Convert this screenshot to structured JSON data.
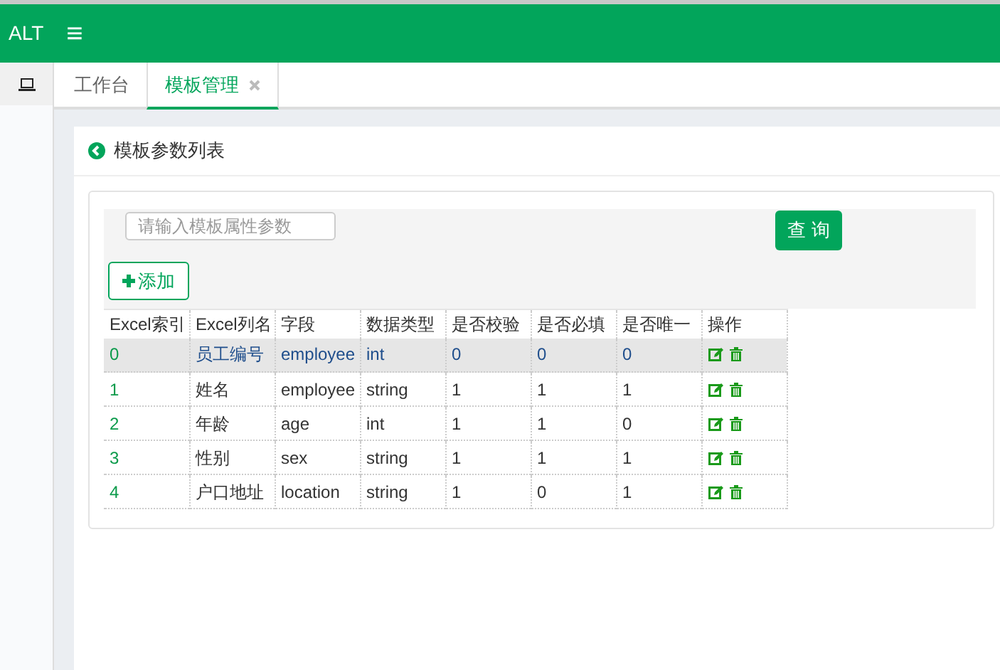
{
  "header": {
    "logo": "ALT",
    "menu_icon": "≡"
  },
  "tabs": [
    {
      "label": "工作台",
      "selected": false,
      "closable": false
    },
    {
      "label": "模板管理",
      "selected": true,
      "closable": true
    }
  ],
  "panel": {
    "title": "模板参数列表"
  },
  "search": {
    "placeholder": "请输入模板属性参数",
    "button": "查 询"
  },
  "add_button": "添加",
  "table": {
    "columns": [
      "Excel索引",
      "Excel列名",
      "字段",
      "数据类型",
      "是否校验",
      "是否必填",
      "是否唯一",
      "操作"
    ],
    "rows": [
      {
        "selected": true,
        "cells": [
          "0",
          "员工编号",
          "employee",
          "int",
          "0",
          "0",
          "0"
        ]
      },
      {
        "selected": false,
        "cells": [
          "1",
          "姓名",
          "employee",
          "string",
          "1",
          "1",
          "1"
        ]
      },
      {
        "selected": false,
        "cells": [
          "2",
          "年龄",
          "age",
          "int",
          "1",
          "1",
          "0"
        ]
      },
      {
        "selected": false,
        "cells": [
          "3",
          "性别",
          "sex",
          "string",
          "1",
          "1",
          "1"
        ]
      },
      {
        "selected": false,
        "cells": [
          "4",
          "户口地址",
          "location",
          "string",
          "1",
          "0",
          "1"
        ]
      }
    ]
  }
}
